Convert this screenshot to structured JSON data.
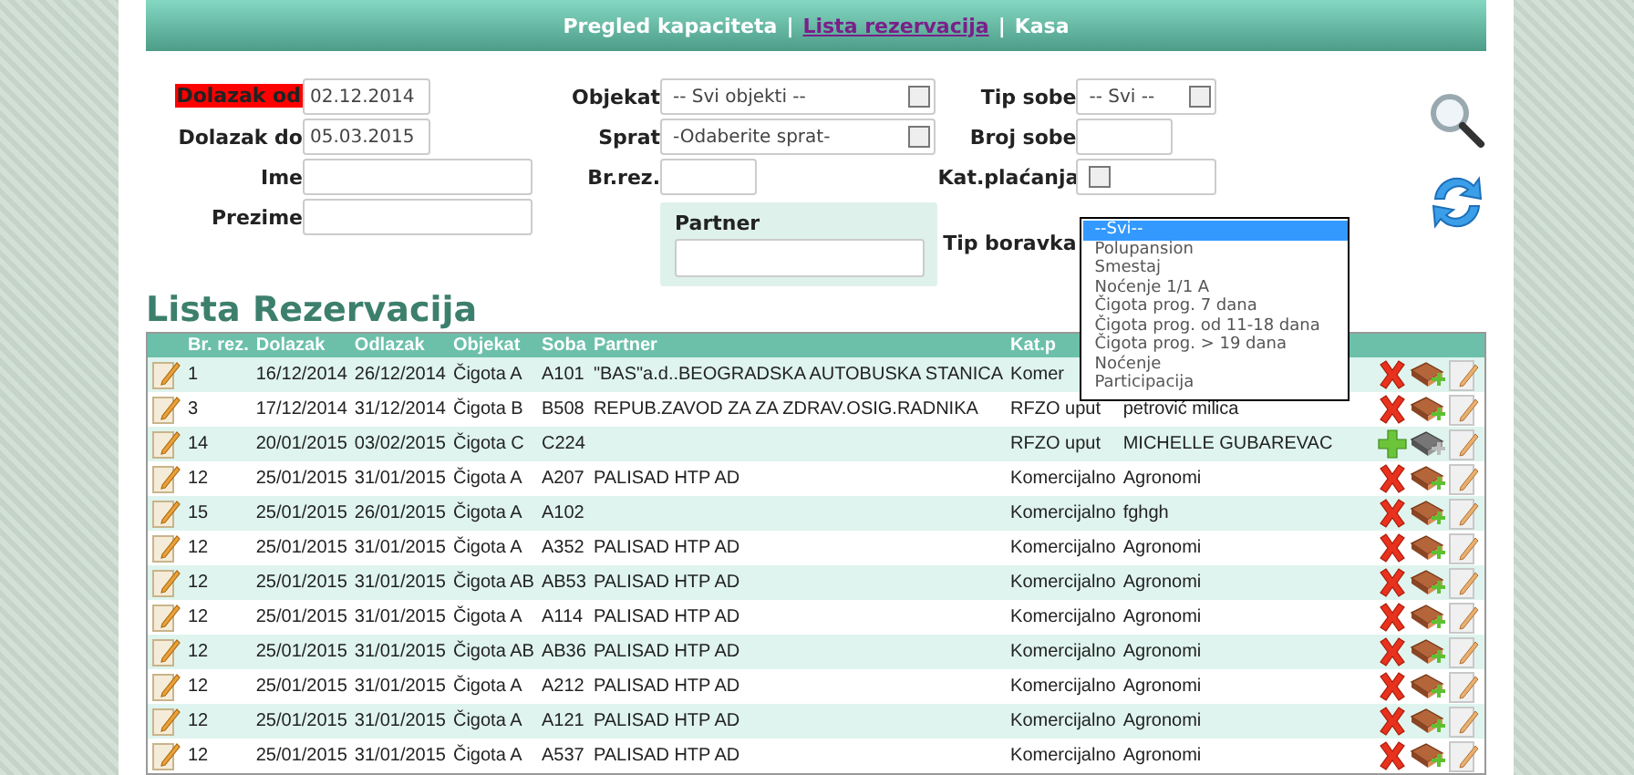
{
  "nav": {
    "separators": [
      "|",
      "|"
    ],
    "items": [
      {
        "label": "Pregled kapaciteta",
        "selected": false
      },
      {
        "label": "Lista rezervacija",
        "selected": true
      },
      {
        "label": "Kasa",
        "selected": false
      }
    ]
  },
  "filter_columns": [
    [
      {
        "kind": "date",
        "label": "Dolazak od",
        "value": "02.12.2014",
        "error": true
      },
      {
        "kind": "date",
        "label": "Dolazak do",
        "value": "05.03.2015",
        "error": false
      },
      {
        "kind": "text",
        "label": "Ime",
        "error": false
      },
      {
        "kind": "text",
        "label": "Prezime",
        "error": false
      }
    ],
    [
      {
        "kind": "select",
        "label": "Objekat",
        "value": "-- Svi objekti --"
      },
      {
        "kind": "select",
        "label": "Sprat",
        "value": "-Odaberite sprat-"
      },
      {
        "kind": "short",
        "label": "Br.rez."
      },
      {
        "kind": "partner",
        "label": "Partner"
      }
    ],
    [
      {
        "kind": "smallselect",
        "label": "Tip sobe",
        "value": "-- Svi --"
      },
      {
        "kind": "short",
        "label": "Broj sobe"
      },
      {
        "kind": "smallselect",
        "label": "Kat.plaćanja"
      },
      {
        "kind": "listbox",
        "label": "Tip boravka",
        "options": [
          {
            "label": "--Svi--",
            "selected": true
          },
          {
            "label": "Polupansion",
            "selected": false
          },
          {
            "label": "Smestaj",
            "selected": false
          },
          {
            "label": "Noćenje 1/1 A",
            "selected": false
          },
          {
            "label": "Čigota prog. 7 dana",
            "selected": false
          },
          {
            "label": "Čigota prog. od 11-18 dana",
            "selected": false
          },
          {
            "label": "Čigota prog. > 19 dana",
            "selected": false
          },
          {
            "label": "Noćenje",
            "selected": false
          },
          {
            "label": "Participacija",
            "selected": false
          }
        ]
      }
    ]
  ],
  "heading": "Lista Rezervacija",
  "table": {
    "columns": [
      "Br. rez.",
      "Dolazak",
      "Odlazak",
      "Objekat",
      "Soba",
      "Partner",
      "Kat.p"
    ],
    "rows": [
      {
        "kind": "delete",
        "cells": [
          "1",
          "16/12/2014",
          "26/12/2014",
          "Čigota A",
          "A101",
          "\"BAS\"a.d..BEOGRADSKA AUTOBUSKA STANICA",
          "Komer"
        ]
      },
      {
        "kind": "delete",
        "cells": [
          "3",
          "17/12/2014",
          "31/12/2014",
          "Čigota B",
          "B508",
          "REPUB.ZAVOD ZA ZA ZDRAV.OSIG.RADNIKA",
          "RFZO uput",
          "petrović milica"
        ]
      },
      {
        "kind": "add",
        "cells": [
          "14",
          "20/01/2015",
          "03/02/2015",
          "Čigota C",
          "C224",
          "",
          "RFZO uput",
          "MICHELLE GUBAREVAC"
        ]
      },
      {
        "kind": "delete",
        "cells": [
          "12",
          "25/01/2015",
          "31/01/2015",
          "Čigota A",
          "A207",
          "PALISAD HTP AD",
          "Komercijalno",
          "Agronomi"
        ]
      },
      {
        "kind": "delete",
        "cells": [
          "15",
          "25/01/2015",
          "26/01/2015",
          "Čigota A",
          "A102",
          "",
          "Komercijalno",
          "fghgh"
        ]
      },
      {
        "kind": "delete",
        "cells": [
          "12",
          "25/01/2015",
          "31/01/2015",
          "Čigota A",
          "A352",
          "PALISAD HTP AD",
          "Komercijalno",
          "Agronomi"
        ]
      },
      {
        "kind": "delete",
        "cells": [
          "12",
          "25/01/2015",
          "31/01/2015",
          "Čigota AB",
          "AB53",
          "PALISAD HTP AD",
          "Komercijalno",
          "Agronomi"
        ]
      },
      {
        "kind": "delete",
        "cells": [
          "12",
          "25/01/2015",
          "31/01/2015",
          "Čigota A",
          "A114",
          "PALISAD HTP AD",
          "Komercijalno",
          "Agronomi"
        ]
      },
      {
        "kind": "delete",
        "cells": [
          "12",
          "25/01/2015",
          "31/01/2015",
          "Čigota AB",
          "AB36",
          "PALISAD HTP AD",
          "Komercijalno",
          "Agronomi"
        ]
      },
      {
        "kind": "delete",
        "cells": [
          "12",
          "25/01/2015",
          "31/01/2015",
          "Čigota A",
          "A212",
          "PALISAD HTP AD",
          "Komercijalno",
          "Agronomi"
        ]
      },
      {
        "kind": "delete",
        "cells": [
          "12",
          "25/01/2015",
          "31/01/2015",
          "Čigota A",
          "A121",
          "PALISAD HTP AD",
          "Komercijalno",
          "Agronomi"
        ]
      },
      {
        "kind": "delete",
        "cells": [
          "12",
          "25/01/2015",
          "31/01/2015",
          "Čigota A",
          "A537",
          "PALISAD HTP AD",
          "Komercijalno",
          "Agronomi"
        ]
      }
    ]
  }
}
